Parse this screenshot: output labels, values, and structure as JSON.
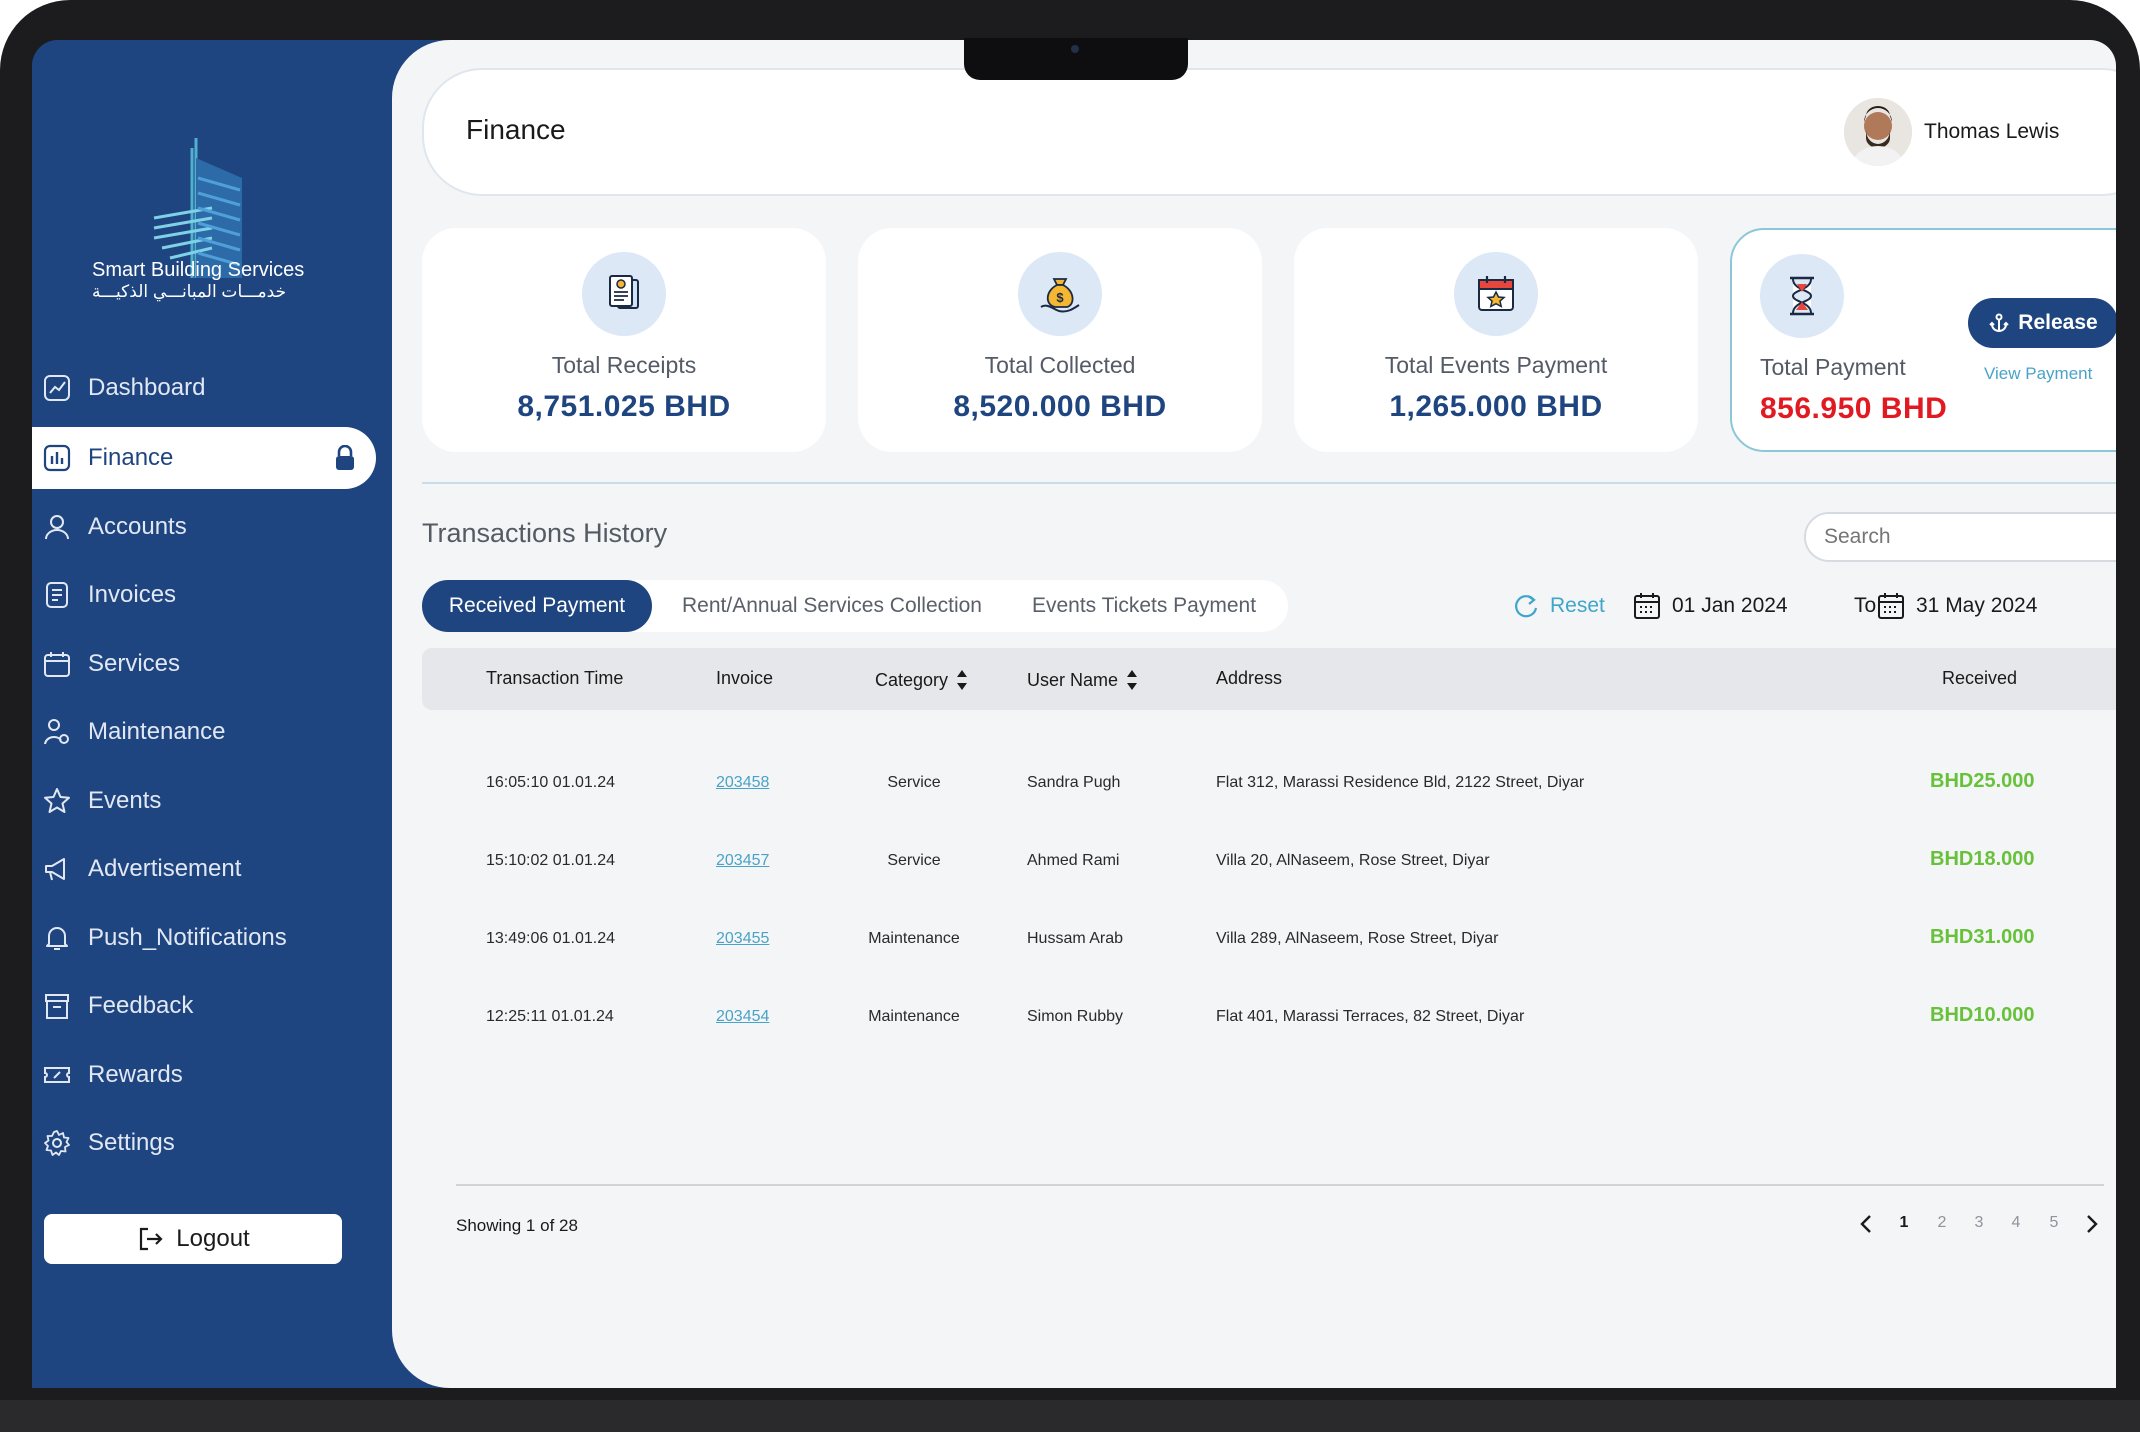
{
  "brand": {
    "name": "Smart Building Services",
    "arabic_name": "خدمـــات المبانـــي الذكيـــة"
  },
  "sidebar": {
    "items": [
      {
        "label": "Dashboard",
        "icon": "dashboard-chart-icon"
      },
      {
        "label": "Finance",
        "icon": "finance-icon",
        "active": true
      },
      {
        "label": "Accounts",
        "icon": "user-icon"
      },
      {
        "label": "Invoices",
        "icon": "invoice-icon"
      },
      {
        "label": "Services",
        "icon": "calendar-icon"
      },
      {
        "label": "Maintenance",
        "icon": "maintenance-icon"
      },
      {
        "label": "Events",
        "icon": "star-icon"
      },
      {
        "label": "Advertisement",
        "icon": "megaphone-icon"
      },
      {
        "label": "Push_Notifications",
        "icon": "bell-icon"
      },
      {
        "label": "Feedback",
        "icon": "archive-icon"
      },
      {
        "label": "Rewards",
        "icon": "ticket-icon"
      },
      {
        "label": "Settings",
        "icon": "gear-icon"
      }
    ],
    "logout_label": "Logout"
  },
  "header": {
    "title": "Finance",
    "user_name": "Thomas Lewis"
  },
  "cards": [
    {
      "label": "Total Receipts",
      "value": "8,751.025 BHD",
      "icon": "receipt-icon"
    },
    {
      "label": "Total Collected",
      "value": "8,520.000 BHD",
      "icon": "money-bag-icon"
    },
    {
      "label": "Total Events Payment",
      "value": "1,265.000 BHD",
      "icon": "event-calendar-icon"
    },
    {
      "label": "Total Payment",
      "value": "856.950 BHD",
      "icon": "hourglass-icon",
      "release_label": "Release",
      "view_label": "View Payment"
    }
  ],
  "transactions": {
    "title": "Transactions History",
    "search_placeholder": "Search",
    "tabs": [
      "Received Payment",
      "Rent/Annual Services Collection",
      "Events Tickets Payment"
    ],
    "active_tab": 0,
    "reset_label": "Reset",
    "date_from": "01 Jan 2024",
    "to_label": "To",
    "date_to": "31 May 2024",
    "columns": [
      "Transaction Time",
      "Invoice",
      "Category",
      "User Name",
      "Address",
      "Received"
    ],
    "rows": [
      {
        "time": "16:05:10  01.01.24",
        "invoice": "203458",
        "category": "Service",
        "user": "Sandra Pugh",
        "address": "Flat 312, Marassi Residence Bld, 2122 Street, Diyar",
        "received": "BHD25.000"
      },
      {
        "time": "15:10:02  01.01.24",
        "invoice": "203457",
        "category": "Service",
        "user": "Ahmed Rami",
        "address": "Villa 20, AlNaseem, Rose Street, Diyar",
        "received": "BHD18.000"
      },
      {
        "time": "13:49:06  01.01.24",
        "invoice": "203455",
        "category": "Maintenance",
        "user": "Hussam Arab",
        "address": "Villa 289, AlNaseem, Rose Street, Diyar",
        "received": "BHD31.000"
      },
      {
        "time": "12:25:11  01.01.24",
        "invoice": "203454",
        "category": "Maintenance",
        "user": "Simon Rubby",
        "address": "Flat 401, Marassi Terraces, 82 Street, Diyar",
        "received": "BHD10.000"
      }
    ],
    "showing": "Showing 1 of 28",
    "pages": [
      "1",
      "2",
      "3",
      "4",
      "5"
    ],
    "current_page": "1"
  },
  "colors": {
    "primary": "#1f4580",
    "accent": "#4aa3c7",
    "positive": "#67c23a",
    "alert": "#e11a22"
  }
}
